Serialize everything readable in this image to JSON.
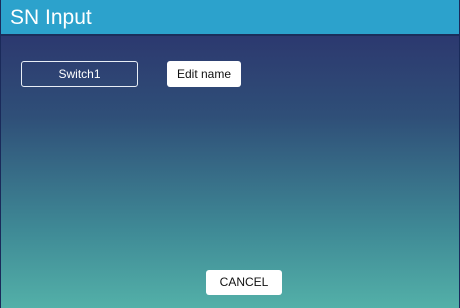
{
  "window": {
    "title": "SN Input"
  },
  "form": {
    "name_value": "Switch1",
    "edit_button_label": "Edit name"
  },
  "footer": {
    "cancel_label": "CANCEL"
  },
  "colors": {
    "title_bar": "#2ca2cc",
    "background_top": "#2b2f6b",
    "background_bottom": "#53b0a8",
    "button_bg": "#ffffff"
  }
}
